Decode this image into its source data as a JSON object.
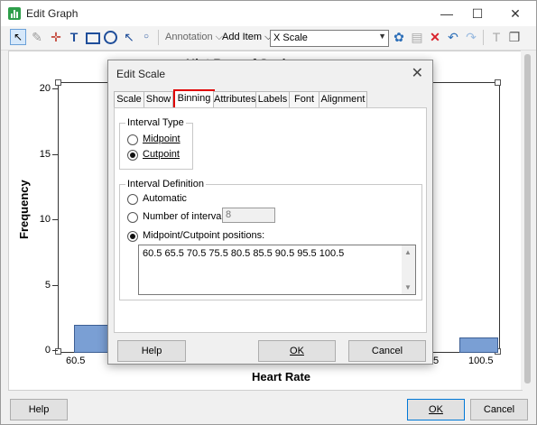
{
  "window": {
    "title": "Edit Graph",
    "controls": {
      "minimize": "—",
      "maximize": "☐",
      "close": "✕"
    }
  },
  "toolbar": {
    "annotation_label": "Annotation",
    "add_item_label": "Add Item",
    "combo_value": "X Scale"
  },
  "graph": {
    "title_fragment": "Hist  Ram  of Scale",
    "chart_data": {
      "type": "bar",
      "ylabel": "Frequency",
      "xlabel": "Heart Rate",
      "ylim": [
        0,
        20
      ],
      "yticks": [
        "20",
        "15",
        "10",
        "5",
        "0"
      ],
      "xticks": [
        "60.5",
        ".5",
        "100.5"
      ],
      "visible_bars": [
        {
          "x_start": 60.5,
          "x_end": 65.5,
          "value": 2
        },
        {
          "x_start": 95.5,
          "x_end": 100.5,
          "value": 1
        }
      ]
    }
  },
  "bottom": {
    "help": "Help",
    "ok": "OK",
    "cancel": "Cancel"
  },
  "dialog": {
    "title": "Edit Scale",
    "close": "✕",
    "tabs": [
      "Scale",
      "Show",
      "Binning",
      "Attributes",
      "Labels",
      "Font",
      "Alignment"
    ],
    "active_tab": "Binning",
    "interval_type": {
      "label": "Interval Type",
      "midpoint": "Midpoint",
      "cutpoint": "Cutpoint",
      "selected": "Cutpoint"
    },
    "interval_definition": {
      "label": "Interval Definition",
      "automatic": "Automatic",
      "number_of_intervals": "Number of intervals:",
      "number_value": "8",
      "positions_label": "Midpoint/Cutpoint positions:",
      "positions_value": "60.5 65.5 70.5 75.5 80.5 85.5 90.5 95.5 100.5",
      "selected": "Midpoint/Cutpoint positions"
    },
    "buttons": {
      "help": "Help",
      "ok": "OK",
      "cancel": "Cancel"
    }
  },
  "colors": {
    "bar_fill": "#7a9fd4",
    "highlight": "#e00000"
  }
}
